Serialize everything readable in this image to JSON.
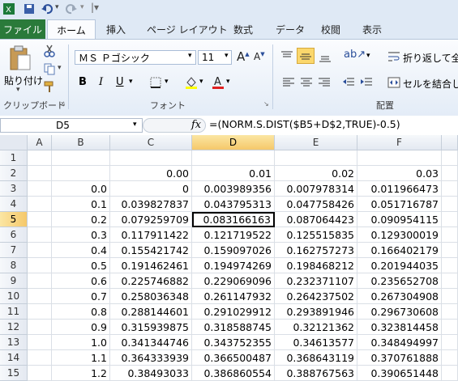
{
  "qat": {
    "icons": [
      "excel-app-icon",
      "save-icon",
      "undo-icon",
      "redo-icon",
      "customize-icon"
    ]
  },
  "tabs": {
    "file": "ファイル",
    "home": "ホーム",
    "insert": "挿入",
    "page_layout": "ページ レイアウト",
    "formulas": "数式",
    "data": "データ",
    "review": "校閲",
    "view": "表示"
  },
  "ribbon": {
    "paste_label": "貼り付け",
    "clipboard_label": "クリップボード",
    "font_name": "ＭＳ Ｐゴシック",
    "font_size": "11",
    "font_group_label": "フォント",
    "align_group_label": "配置",
    "wrap_text": "折り返して全",
    "merge_center": "セルを結合して"
  },
  "formula_bar": {
    "name_box": "D5",
    "fx": "fx",
    "formula": "=(NORM.S.DIST($B5+D$2,TRUE)-0.5)"
  },
  "grid": {
    "columns": [
      "A",
      "B",
      "C",
      "D",
      "E",
      "F"
    ],
    "rows": [
      "1",
      "2",
      "3",
      "4",
      "5",
      "6",
      "7",
      "8",
      "9",
      "10",
      "11",
      "12",
      "13",
      "14",
      "15"
    ],
    "cells": [
      [
        "",
        "",
        "",
        "",
        "",
        ""
      ],
      [
        "",
        "",
        "0.00",
        "0.01",
        "0.02",
        "0.03"
      ],
      [
        "",
        "0.0",
        "0",
        "0.003989356",
        "0.007978314",
        "0.011966473"
      ],
      [
        "",
        "0.1",
        "0.039827837",
        "0.043795313",
        "0.047758426",
        "0.051716787"
      ],
      [
        "",
        "0.2",
        "0.079259709",
        "0.083166163",
        "0.087064423",
        "0.090954115"
      ],
      [
        "",
        "0.3",
        "0.117911422",
        "0.121719522",
        "0.125515835",
        "0.129300019"
      ],
      [
        "",
        "0.4",
        "0.155421742",
        "0.159097026",
        "0.162757273",
        "0.166402179"
      ],
      [
        "",
        "0.5",
        "0.191462461",
        "0.194974269",
        "0.198468212",
        "0.201944035"
      ],
      [
        "",
        "0.6",
        "0.225746882",
        "0.229069096",
        "0.232371107",
        "0.235652708"
      ],
      [
        "",
        "0.7",
        "0.258036348",
        "0.261147932",
        "0.264237502",
        "0.267304908"
      ],
      [
        "",
        "0.8",
        "0.288144601",
        "0.291029912",
        "0.293891946",
        "0.296730608"
      ],
      [
        "",
        "0.9",
        "0.315939875",
        "0.318588745",
        "0.32121362",
        "0.323814458"
      ],
      [
        "",
        "1.0",
        "0.341344746",
        "0.343752355",
        "0.34613577",
        "0.348494997"
      ],
      [
        "",
        "1.1",
        "0.364333939",
        "0.366500487",
        "0.368643119",
        "0.370761888"
      ],
      [
        "",
        "1.2",
        "0.38493033",
        "0.386860554",
        "0.388767563",
        "0.390651448"
      ]
    ]
  }
}
